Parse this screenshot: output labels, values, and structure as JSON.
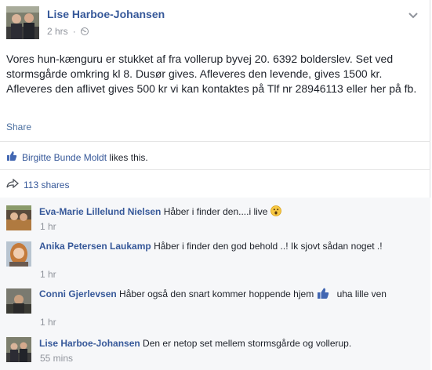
{
  "post": {
    "author": "Lise Harboe-Johansen",
    "time": "2 hrs",
    "text": "Vores hun-kænguru er stukket af fra vollerup byvej 20. 6392 bolderslev. Set ved stormsgårde omkring kl 8. Dusør gives. Afleveres den levende, gives 1500 kr. Afleveres den aflivet gives 500 kr vi kan kontaktes på Tlf nr 28946113 eller her på fb.",
    "share_label": "Share",
    "liker": "Birgitte Bunde Moldt",
    "likes_suffix": "likes this.",
    "shares": "113 shares"
  },
  "comments": [
    {
      "name": "Eva-Marie Lillelund Nielsen",
      "text": "Håber i finder den....i live",
      "time": "1 hr"
    },
    {
      "name": "Anika Petersen Laukamp",
      "text": "Håber i finder den god behold ..! Ik sjovt sådan noget .!",
      "time": "1 hr"
    },
    {
      "name": "Conni Gjerlevsen",
      "text_before": "Håber også den snart kommer hoppende hjem",
      "text_after": "uha lille ven",
      "time": "1 hr"
    },
    {
      "name": "Lise Harboe-Johansen",
      "text": "Den er netop set mellem stormsgårde og vollerup.",
      "time": "55 mins"
    }
  ],
  "icons": {
    "globe": "globe-icon",
    "menu": "chevron-down-icon",
    "like": "thumbs-up-icon",
    "share": "share-arrow-icon",
    "emoji_surprised": "surprised-face-icon",
    "emoji_like": "like-thumb-icon"
  },
  "colors": {
    "link": "#365899",
    "meta": "#90949c",
    "comment_bg": "#f6f7f9"
  }
}
